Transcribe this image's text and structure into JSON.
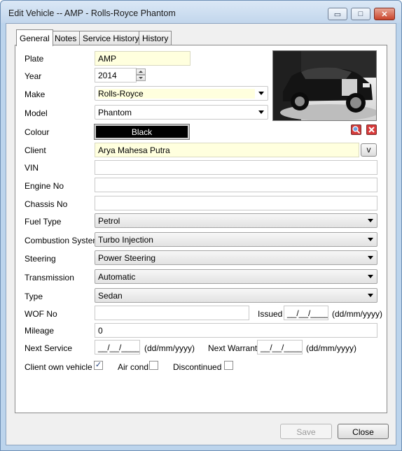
{
  "window": {
    "title": "Edit Vehicle -- AMP - Rolls-Royce Phantom",
    "minimize_glyph": "▭",
    "maximize_glyph": "□",
    "close_glyph": "✕"
  },
  "tabs": [
    {
      "label": "General",
      "active": true
    },
    {
      "label": "Notes",
      "active": false
    },
    {
      "label": "Service History",
      "active": false
    },
    {
      "label": "History",
      "active": false
    }
  ],
  "form": {
    "plate": {
      "label": "Plate",
      "value": "AMP"
    },
    "year": {
      "label": "Year",
      "value": "2014"
    },
    "make": {
      "label": "Make",
      "value": "Rolls-Royce"
    },
    "model": {
      "label": "Model",
      "value": "Phantom"
    },
    "colour": {
      "label": "Colour",
      "value": "Black"
    },
    "client": {
      "label": "Client",
      "value": "Arya Mahesa Putra",
      "button": "v"
    },
    "vin": {
      "label": "VIN",
      "value": ""
    },
    "engine_no": {
      "label": "Engine No",
      "value": ""
    },
    "chassis_no": {
      "label": "Chassis No",
      "value": ""
    },
    "fuel_type": {
      "label": "Fuel Type",
      "value": "Petrol"
    },
    "combustion_system": {
      "label": "Combustion System",
      "value": "Turbo Injection"
    },
    "steering": {
      "label": "Steering",
      "value": "Power Steering"
    },
    "transmission": {
      "label": "Transmission",
      "value": "Automatic"
    },
    "type": {
      "label": "Type",
      "value": "Sedan"
    },
    "wof_no": {
      "label": "WOF No",
      "value": ""
    },
    "issued": {
      "label": "Issued",
      "value": "__/__/____",
      "hint": "(dd/mm/yyyy)"
    },
    "mileage": {
      "label": "Mileage",
      "value": "0"
    },
    "next_service": {
      "label": "Next Service",
      "value": "__/__/____",
      "hint": "(dd/mm/yyyy)"
    },
    "next_warrant": {
      "label": "Next Warrant",
      "value": "__/__/____",
      "hint": "(dd/mm/yyyy)"
    },
    "client_own_vehicle": {
      "label": "Client own vehicle",
      "checked": true,
      "mark": "✓"
    },
    "air_cond": {
      "label": "Air cond",
      "checked": false
    },
    "discontinued": {
      "label": "Discontinued",
      "checked": false
    }
  },
  "photo": {
    "icon": "car-photo"
  },
  "icons": {
    "search": "search-icon",
    "delete": "delete-icon"
  },
  "buttons": {
    "save": "Save",
    "close": "Close"
  },
  "colors": {
    "colour_swatch": "#000000",
    "highlight_field": "#ffffde"
  }
}
